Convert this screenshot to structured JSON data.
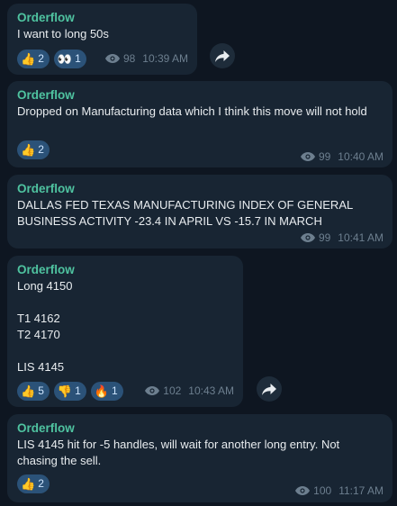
{
  "messages": [
    {
      "sender": "Orderflow",
      "text": "I want to long 50s",
      "reactions": [
        {
          "emoji": "👍",
          "icon": "thumbs-up-icon",
          "count": "2"
        },
        {
          "emoji": "👀",
          "icon": "eyes-icon",
          "count": "1"
        }
      ],
      "views": "98",
      "time": "10:39 AM"
    },
    {
      "sender": "Orderflow",
      "text": "Dropped on Manufacturing data which I think this move will not hold",
      "reactions": [
        {
          "emoji": "👍",
          "icon": "thumbs-up-icon",
          "count": "2"
        }
      ],
      "views": "99",
      "time": "10:40 AM"
    },
    {
      "sender": "Orderflow",
      "text": "DALLAS FED TEXAS MANUFACTURING INDEX OF GENERAL BUSINESS ACTIVITY -23.4 IN APRIL VS -15.7 IN MARCH",
      "reactions": [],
      "views": "99",
      "time": "10:41 AM"
    },
    {
      "sender": "Orderflow",
      "text": "Long 4150\n\nT1 4162\nT2 4170\n\nLIS 4145",
      "reactions": [
        {
          "emoji": "👍",
          "icon": "thumbs-up-icon",
          "count": "5"
        },
        {
          "emoji": "👎",
          "icon": "thumbs-down-icon",
          "count": "1"
        },
        {
          "emoji": "🔥",
          "icon": "fire-icon",
          "count": "1"
        }
      ],
      "views": "102",
      "time": "10:43 AM"
    },
    {
      "sender": "Orderflow",
      "text": "LIS 4145 hit for -5 handles, will wait for another long entry. Not chasing the sell.",
      "reactions": [
        {
          "emoji": "👍",
          "icon": "thumbs-up-icon",
          "count": "2"
        }
      ],
      "views": "100",
      "time": "11:17 AM"
    }
  ]
}
